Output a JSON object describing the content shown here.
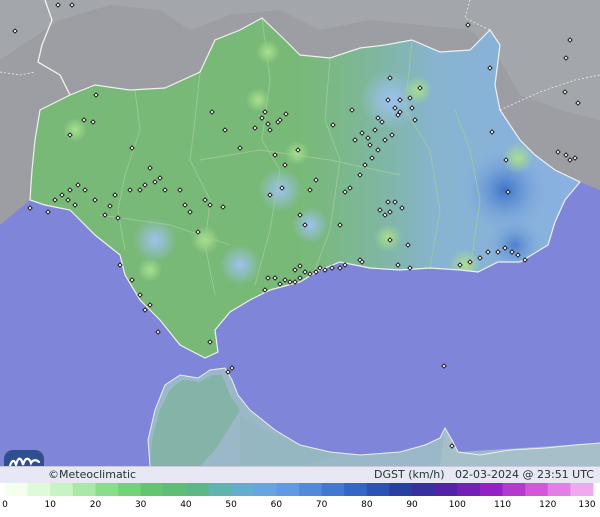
{
  "brand": {
    "symbol": "©",
    "name": "Meteoclimatic"
  },
  "caption": {
    "variable": "DGST (km/h)",
    "date": "02-03-2024",
    "time": "23:51 UTC"
  },
  "legend": {
    "ticks": [
      "0",
      "10",
      "20",
      "30",
      "40",
      "50",
      "60",
      "70",
      "80",
      "90",
      "100",
      "110",
      "120",
      "130"
    ],
    "stops": [
      "#f4fff0",
      "#c8f5c4",
      "#8ee08e",
      "#62c86e",
      "#5cb97a",
      "#64b0c8",
      "#6aa0e8",
      "#4a82d8",
      "#2e5fc0",
      "#263a9c",
      "#5a1fa8",
      "#9a20c8",
      "#d45ad8",
      "#f0a8f0"
    ]
  },
  "map": {
    "sea_color": "#7f86d9",
    "land_outside_color": "#9c9ea3",
    "region_color": "#79b978",
    "station_marker": "station-marker"
  }
}
